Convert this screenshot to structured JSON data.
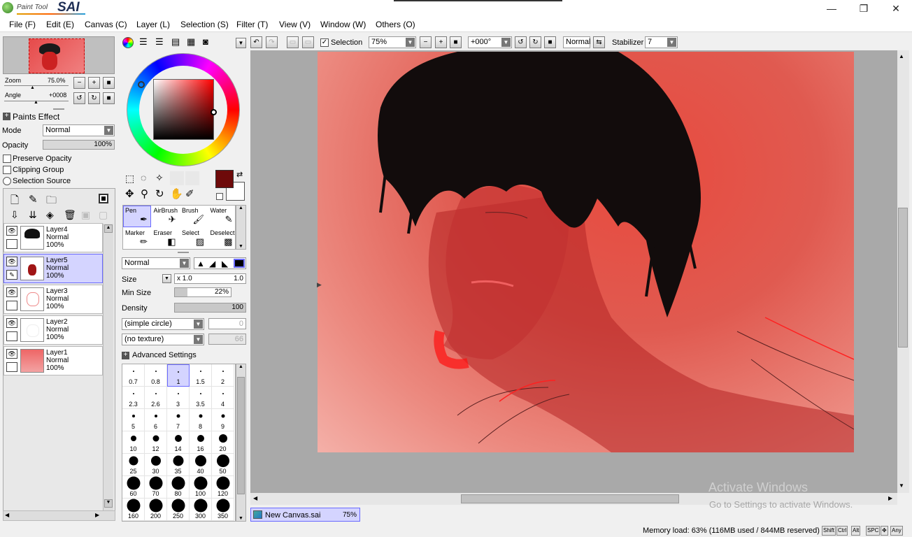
{
  "app": {
    "logo_small": "Paint Tool",
    "logo_big": "SAI"
  },
  "window": {
    "minimize": "—",
    "maximize": "❐",
    "close": "✕"
  },
  "menu": [
    "File (F)",
    "Edit (E)",
    "Canvas (C)",
    "Layer (L)",
    "Selection (S)",
    "Filter (T)",
    "View (V)",
    "Window (W)",
    "Others (O)"
  ],
  "navigator": {
    "zoom_label": "Zoom",
    "zoom_value": "75.0%",
    "angle_label": "Angle",
    "angle_value": "+0008"
  },
  "paints_effect": {
    "title": "Paints Effect",
    "mode_label": "Mode",
    "mode_value": "Normal",
    "opacity_label": "Opacity",
    "opacity_value": "100%",
    "opacity_fraction": 1.0,
    "preserve_opacity": "Preserve Opacity",
    "clipping_group": "Clipping Group",
    "selection_source": "Selection Source"
  },
  "layers": [
    {
      "name": "Layer4",
      "mode": "Normal",
      "opacity": "100%",
      "selected": false
    },
    {
      "name": "Layer5",
      "mode": "Normal",
      "opacity": "100%",
      "selected": true
    },
    {
      "name": "Layer3",
      "mode": "Normal",
      "opacity": "100%",
      "selected": false
    },
    {
      "name": "Layer2",
      "mode": "Normal",
      "opacity": "100%",
      "selected": false
    },
    {
      "name": "Layer1",
      "mode": "Normal",
      "opacity": "100%",
      "selected": false
    }
  ],
  "color": {
    "primary": "#6e0a0a",
    "secondary": "#ffffff",
    "wheel_hue": "#ff0000"
  },
  "tools": [
    {
      "label": "Pen",
      "icon": "pen-icon",
      "glyph": "✒",
      "selected": true
    },
    {
      "label": "AirBrush",
      "icon": "airbrush-icon",
      "glyph": "✈",
      "selected": false
    },
    {
      "label": "Brush",
      "icon": "brush-icon",
      "glyph": "🖌",
      "selected": false
    },
    {
      "label": "Water",
      "icon": "water-icon",
      "glyph": "✎",
      "selected": false
    },
    {
      "label": "Marker",
      "icon": "marker-icon",
      "glyph": "✏",
      "selected": false
    },
    {
      "label": "Eraser",
      "icon": "eraser-icon",
      "glyph": "◧",
      "selected": false
    },
    {
      "label": "Select",
      "icon": "select-icon",
      "glyph": "▨",
      "selected": false
    },
    {
      "label": "Deselect",
      "icon": "deselect-icon",
      "glyph": "▩",
      "selected": false
    }
  ],
  "brush": {
    "blend_mode": "Normal",
    "size_label": "Size",
    "size_mult": "x 1.0",
    "size_value": "1.0",
    "min_size_label": "Min Size",
    "min_size_value": "22%",
    "min_size_fraction": 0.22,
    "density_label": "Density",
    "density_value": "100",
    "density_fraction": 1.0,
    "shape": "(simple circle)",
    "shape_value": "0",
    "texture": "(no texture)",
    "texture_value": "66",
    "advanced": "Advanced Settings"
  },
  "brush_sizes": [
    "0.7",
    "0.8",
    "1",
    "1.5",
    "2",
    "2.3",
    "2.6",
    "3",
    "3.5",
    "4",
    "5",
    "6",
    "7",
    "8",
    "9",
    "10",
    "12",
    "14",
    "16",
    "20",
    "25",
    "30",
    "35",
    "40",
    "50",
    "60",
    "70",
    "80",
    "100",
    "120",
    "160",
    "200",
    "250",
    "300",
    "350"
  ],
  "brush_selected": "1",
  "toolbar": {
    "selection_label": "Selection",
    "zoom": "75%",
    "angle": "+000°",
    "blend": "Normal",
    "stabilizer_label": "Stabilizer",
    "stabilizer_value": "7"
  },
  "canvas_tab": {
    "name": "New Canvas.sai",
    "zoom": "75%"
  },
  "status": {
    "memory": "Memory load: 63% (116MB used / 844MB reserved)",
    "keys": [
      "Shift",
      "Ctrl",
      "Alt",
      "SPC",
      "✥",
      "Any"
    ]
  },
  "watermark": {
    "line1": "Activate Windows",
    "line2": "Go to Settings to activate Windows."
  }
}
